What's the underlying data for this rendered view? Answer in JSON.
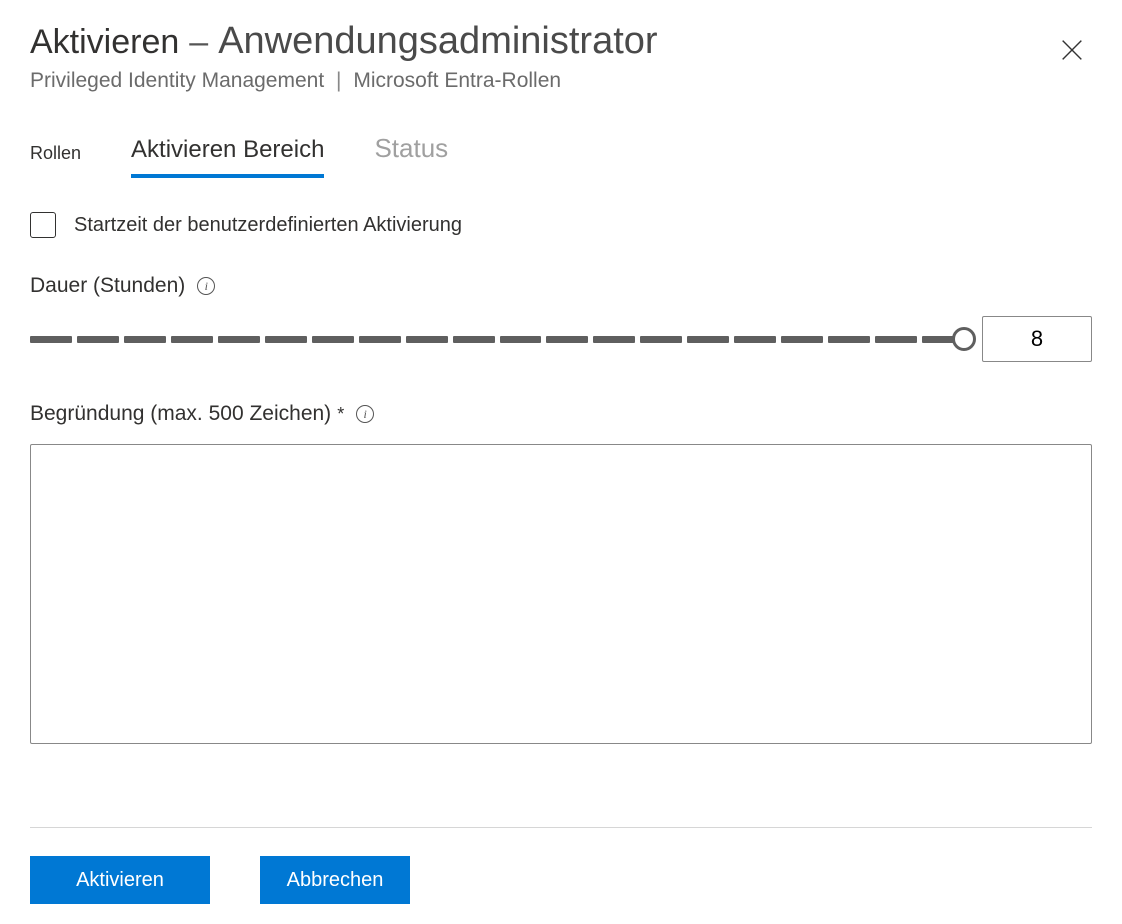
{
  "header": {
    "title_prefix": "Aktivieren",
    "title_dash": "–",
    "title_role": "Anwendungsadministrator"
  },
  "breadcrumb": {
    "service": "Privileged Identity Management",
    "section": "Microsoft Entra-Rollen",
    "separator": "|"
  },
  "tabs": {
    "roles": "Rollen",
    "activate_scope": "Aktivieren Bereich",
    "status": "Status"
  },
  "form": {
    "custom_start_label": "Startzeit der benutzerdefinierten Aktivierung",
    "duration_label": "Dauer (Stunden)",
    "duration_value": "8",
    "reason_label": "Begründung (max. 500 Zeichen)",
    "required_mark": "*",
    "reason_value": ""
  },
  "footer": {
    "activate": "Aktivieren",
    "cancel": "Abbrechen"
  }
}
